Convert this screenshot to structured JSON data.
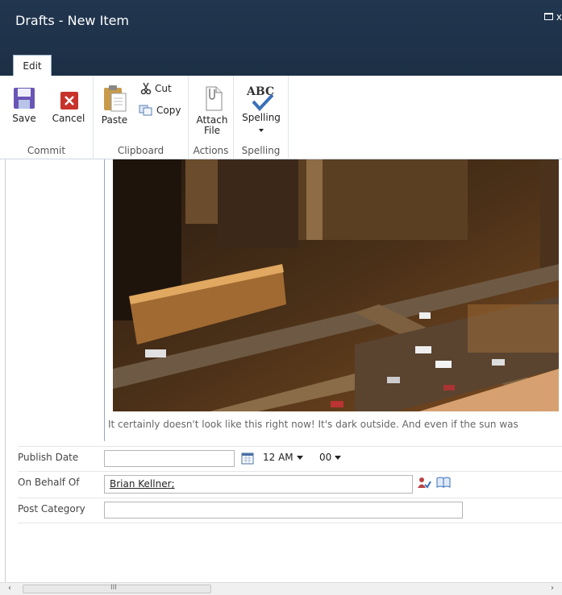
{
  "window": {
    "title": "Drafts - New Item",
    "close_label": "x"
  },
  "ribbon": {
    "tab": "Edit",
    "commit": {
      "label": "Commit",
      "save": "Save",
      "cancel": "Cancel"
    },
    "clipboard": {
      "label": "Clipboard",
      "paste": "Paste",
      "cut": "Cut",
      "copy": "Copy"
    },
    "actions": {
      "label": "Actions",
      "attach_line1": "Attach",
      "attach_line2": "File"
    },
    "spelling": {
      "label": "Spelling",
      "button": "Spelling",
      "icon_text": "ABC"
    }
  },
  "content": {
    "caption": "It certainly doesn't look like this right now!  It's dark outside.  And even if the sun was",
    "fields": {
      "publish_date": {
        "label": "Publish Date",
        "date_value": "",
        "hour": "12 AM",
        "minute": "00"
      },
      "on_behalf_of": {
        "label": "On Behalf Of",
        "value": "Brian Kellner;"
      },
      "post_category": {
        "label": "Post Category",
        "value": ""
      }
    }
  },
  "scrollbar": {
    "grip": "III"
  },
  "colors": {
    "title_bar": "#1f3349",
    "accent": "#3a70b8"
  }
}
